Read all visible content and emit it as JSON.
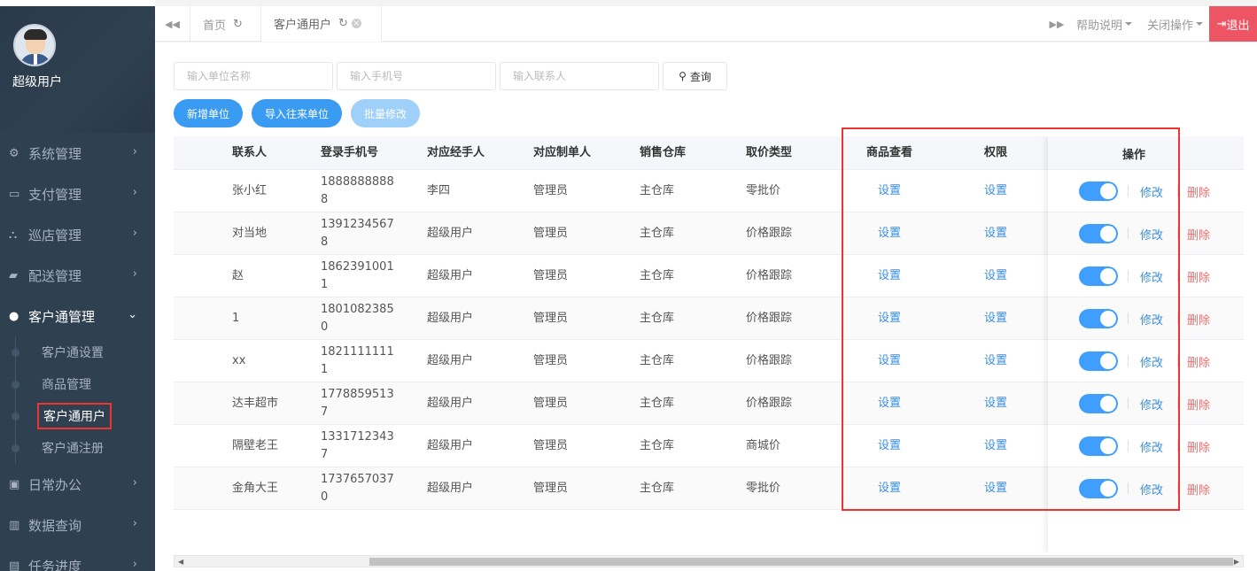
{
  "sidebar": {
    "user_name": "超级用户",
    "menu": [
      {
        "label": "系统管理",
        "icon": "gears-icon"
      },
      {
        "label": "支付管理",
        "icon": "credit-card-icon"
      },
      {
        "label": "巡店管理",
        "icon": "sitemap-icon"
      },
      {
        "label": "配送管理",
        "icon": "truck-icon"
      },
      {
        "label": "客户通管理",
        "icon": "users-icon"
      }
    ],
    "submenu": [
      "客户通设置",
      "商品管理",
      "客户通用户",
      "客户通注册"
    ],
    "menu_after": [
      {
        "label": "日常办公",
        "icon": "briefcase-icon"
      },
      {
        "label": "数据查询",
        "icon": "bar-chart-icon"
      },
      {
        "label": "任务进度",
        "icon": "tasks-icon"
      }
    ]
  },
  "topbar": {
    "tabs": [
      "首页",
      "客户通用户"
    ],
    "help": "帮助说明",
    "close_ops": "关闭操作",
    "exit": "退出"
  },
  "search": {
    "unit_placeholder": "输入单位名称",
    "phone_placeholder": "输入手机号",
    "contact_placeholder": "输入联系人",
    "query": "查询"
  },
  "buttons": {
    "add_unit": "新增单位",
    "import_units": "导入往来单位",
    "batch_edit": "批量修改"
  },
  "table": {
    "headers": {
      "contact": "联系人",
      "phone": "登录手机号",
      "handler": "对应经手人",
      "maker": "对应制单人",
      "warehouse": "销售仓库",
      "price_type": "取价类型",
      "goods_view": "商品查看",
      "permission": "权限",
      "operation": "操作"
    },
    "set_label": "设置",
    "edit_label": "修改",
    "delete_label": "删除",
    "rows": [
      {
        "contact": "张小红",
        "phone": "18888888888",
        "handler": "李四",
        "maker": "管理员",
        "warehouse": "主仓库",
        "price_type": "零批价",
        "enabled": true
      },
      {
        "contact": "对当地",
        "phone": "13912345678",
        "handler": "超级用户",
        "maker": "管理员",
        "warehouse": "主仓库",
        "price_type": "价格跟踪",
        "enabled": true
      },
      {
        "contact": "赵",
        "phone": "18623910011",
        "handler": "超级用户",
        "maker": "管理员",
        "warehouse": "主仓库",
        "price_type": "价格跟踪",
        "enabled": true
      },
      {
        "contact": "1",
        "phone": "18010823850",
        "handler": "超级用户",
        "maker": "管理员",
        "warehouse": "主仓库",
        "price_type": "价格跟踪",
        "enabled": true
      },
      {
        "contact": "xx",
        "phone": "18211111111",
        "handler": "超级用户",
        "maker": "管理员",
        "warehouse": "主仓库",
        "price_type": "价格跟踪",
        "enabled": true
      },
      {
        "contact": "达丰超市",
        "phone": "17788595137",
        "handler": "超级用户",
        "maker": "管理员",
        "warehouse": "主仓库",
        "price_type": "价格跟踪",
        "enabled": true
      },
      {
        "contact": "隔壁老王",
        "phone": "13317123437",
        "handler": "超级用户",
        "maker": "管理员",
        "warehouse": "主仓库",
        "price_type": "商城价",
        "enabled": true
      },
      {
        "contact": "金角大王",
        "phone": "17376570370",
        "handler": "超级用户",
        "maker": "管理员",
        "warehouse": "主仓库",
        "price_type": "零批价",
        "enabled": true
      }
    ]
  },
  "colors": {
    "sidebar_bg": "#2f4050",
    "primary": "#3a9bf3",
    "link": "#3a8ee6",
    "danger": "#f56c6c",
    "exit_bg": "#ed5565",
    "highlight": "#ee3333"
  }
}
